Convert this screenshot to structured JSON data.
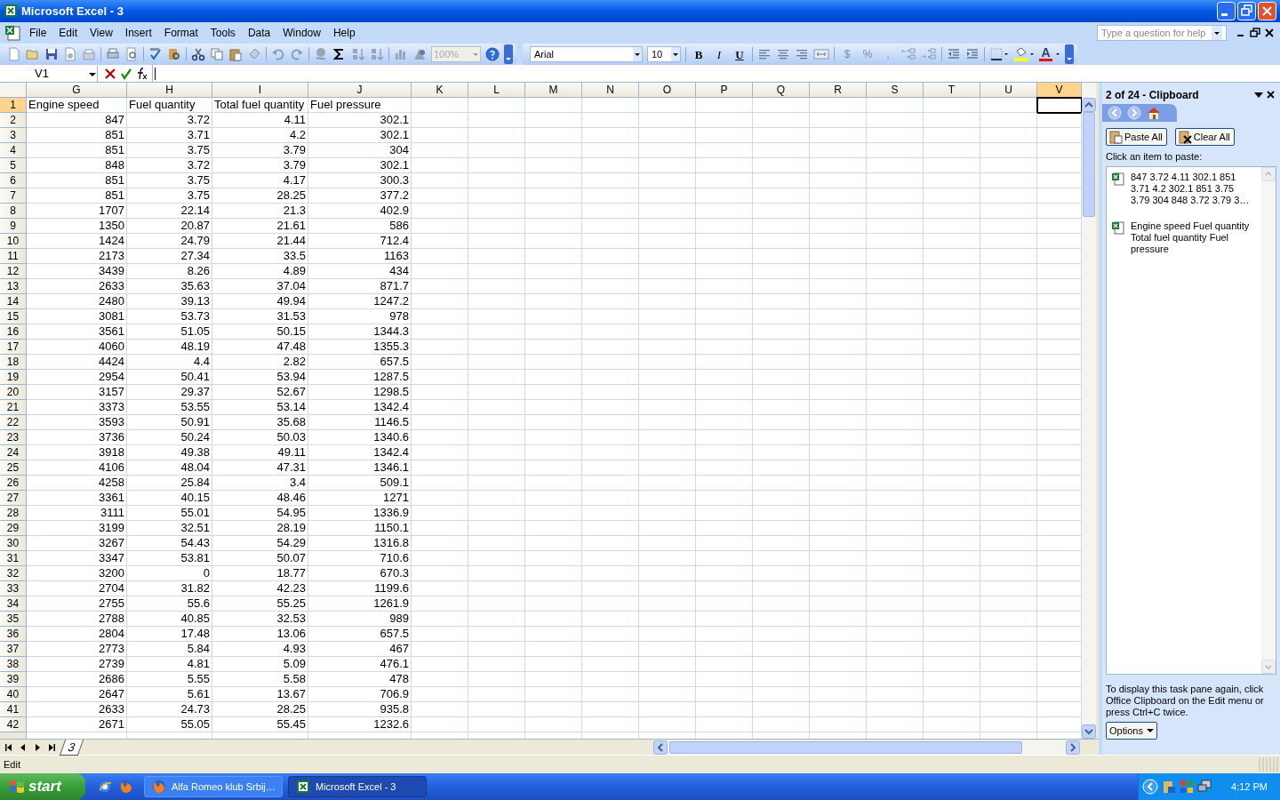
{
  "window": {
    "title": "Microsoft Excel - 3"
  },
  "menu": [
    {
      "label": "File"
    },
    {
      "label": "Edit"
    },
    {
      "label": "View"
    },
    {
      "label": "Insert"
    },
    {
      "label": "Format"
    },
    {
      "label": "Tools"
    },
    {
      "label": "Data"
    },
    {
      "label": "Window"
    },
    {
      "label": "Help"
    }
  ],
  "help_box": {
    "placeholder": "Type a question for help"
  },
  "standard_toolbar": {
    "zoom": "100%"
  },
  "formatting_toolbar": {
    "font": "Arial",
    "size": "10",
    "style_buttons": [
      "B",
      "I",
      "U"
    ],
    "number_buttons": [
      "$",
      "%",
      ","
    ],
    "font_color": "A"
  },
  "formula_bar": {
    "name_box": "V1"
  },
  "sheet": {
    "columns": [
      {
        "label": "G",
        "selected": false
      },
      {
        "label": "H",
        "selected": false
      },
      {
        "label": "I",
        "selected": false
      },
      {
        "label": "J",
        "selected": false
      },
      {
        "label": "K",
        "selected": false
      },
      {
        "label": "L",
        "selected": false
      },
      {
        "label": "M",
        "selected": false
      },
      {
        "label": "N",
        "selected": false
      },
      {
        "label": "O",
        "selected": false
      },
      {
        "label": "P",
        "selected": false
      },
      {
        "label": "Q",
        "selected": false
      },
      {
        "label": "R",
        "selected": false
      },
      {
        "label": "S",
        "selected": false
      },
      {
        "label": "T",
        "selected": false
      },
      {
        "label": "U",
        "selected": false
      },
      {
        "label": "V",
        "selected": true
      }
    ],
    "rows": [
      {
        "header": "1",
        "selected": true,
        "kind": "text",
        "cells": [
          "Engine speed",
          "Fuel quantity",
          "Total fuel quantity",
          "Fuel pressure"
        ]
      },
      {
        "header": "2",
        "selected": false,
        "kind": "number",
        "cells": [
          "847",
          "3.72",
          "4.11",
          "302.1"
        ]
      },
      {
        "header": "3",
        "selected": false,
        "kind": "number",
        "cells": [
          "851",
          "3.71",
          "4.2",
          "302.1"
        ]
      },
      {
        "header": "4",
        "selected": false,
        "kind": "number",
        "cells": [
          "851",
          "3.75",
          "3.79",
          "304"
        ]
      },
      {
        "header": "5",
        "selected": false,
        "kind": "number",
        "cells": [
          "848",
          "3.72",
          "3.79",
          "302.1"
        ]
      },
      {
        "header": "6",
        "selected": false,
        "kind": "number",
        "cells": [
          "851",
          "3.75",
          "4.17",
          "300.3"
        ]
      },
      {
        "header": "7",
        "selected": false,
        "kind": "number",
        "cells": [
          "851",
          "3.75",
          "28.25",
          "377.2"
        ]
      },
      {
        "header": "8",
        "selected": false,
        "kind": "number",
        "cells": [
          "1707",
          "22.14",
          "21.3",
          "402.9"
        ]
      },
      {
        "header": "9",
        "selected": false,
        "kind": "number",
        "cells": [
          "1350",
          "20.87",
          "21.61",
          "586"
        ]
      },
      {
        "header": "10",
        "selected": false,
        "kind": "number",
        "cells": [
          "1424",
          "24.79",
          "21.44",
          "712.4"
        ]
      },
      {
        "header": "11",
        "selected": false,
        "kind": "number",
        "cells": [
          "2173",
          "27.34",
          "33.5",
          "1163"
        ]
      },
      {
        "header": "12",
        "selected": false,
        "kind": "number",
        "cells": [
          "3439",
          "8.26",
          "4.89",
          "434"
        ]
      },
      {
        "header": "13",
        "selected": false,
        "kind": "number",
        "cells": [
          "2633",
          "35.63",
          "37.04",
          "871.7"
        ]
      },
      {
        "header": "14",
        "selected": false,
        "kind": "number",
        "cells": [
          "2480",
          "39.13",
          "49.94",
          "1247.2"
        ]
      },
      {
        "header": "15",
        "selected": false,
        "kind": "number",
        "cells": [
          "3081",
          "53.73",
          "31.53",
          "978"
        ]
      },
      {
        "header": "16",
        "selected": false,
        "kind": "number",
        "cells": [
          "3561",
          "51.05",
          "50.15",
          "1344.3"
        ]
      },
      {
        "header": "17",
        "selected": false,
        "kind": "number",
        "cells": [
          "4060",
          "48.19",
          "47.48",
          "1355.3"
        ]
      },
      {
        "header": "18",
        "selected": false,
        "kind": "number",
        "cells": [
          "4424",
          "4.4",
          "2.82",
          "657.5"
        ]
      },
      {
        "header": "19",
        "selected": false,
        "kind": "number",
        "cells": [
          "2954",
          "50.41",
          "53.94",
          "1287.5"
        ]
      },
      {
        "header": "20",
        "selected": false,
        "kind": "number",
        "cells": [
          "3157",
          "29.37",
          "52.67",
          "1298.5"
        ]
      },
      {
        "header": "21",
        "selected": false,
        "kind": "number",
        "cells": [
          "3373",
          "53.55",
          "53.14",
          "1342.4"
        ]
      },
      {
        "header": "22",
        "selected": false,
        "kind": "number",
        "cells": [
          "3593",
          "50.91",
          "35.68",
          "1146.5"
        ]
      },
      {
        "header": "23",
        "selected": false,
        "kind": "number",
        "cells": [
          "3736",
          "50.24",
          "50.03",
          "1340.6"
        ]
      },
      {
        "header": "24",
        "selected": false,
        "kind": "number",
        "cells": [
          "3918",
          "49.38",
          "49.11",
          "1342.4"
        ]
      },
      {
        "header": "25",
        "selected": false,
        "kind": "number",
        "cells": [
          "4106",
          "48.04",
          "47.31",
          "1346.1"
        ]
      },
      {
        "header": "26",
        "selected": false,
        "kind": "number",
        "cells": [
          "4258",
          "25.84",
          "3.4",
          "509.1"
        ]
      },
      {
        "header": "27",
        "selected": false,
        "kind": "number",
        "cells": [
          "3361",
          "40.15",
          "48.46",
          "1271"
        ]
      },
      {
        "header": "28",
        "selected": false,
        "kind": "number",
        "cells": [
          "3111",
          "55.01",
          "54.95",
          "1336.9"
        ]
      },
      {
        "header": "29",
        "selected": false,
        "kind": "number",
        "cells": [
          "3199",
          "32.51",
          "28.19",
          "1150.1"
        ]
      },
      {
        "header": "30",
        "selected": false,
        "kind": "number",
        "cells": [
          "3267",
          "54.43",
          "54.29",
          "1316.8"
        ]
      },
      {
        "header": "31",
        "selected": false,
        "kind": "number",
        "cells": [
          "3347",
          "53.81",
          "50.07",
          "710.6"
        ]
      },
      {
        "header": "32",
        "selected": false,
        "kind": "number",
        "cells": [
          "3200",
          "0",
          "18.77",
          "670.3"
        ]
      },
      {
        "header": "33",
        "selected": false,
        "kind": "number",
        "cells": [
          "2704",
          "31.82",
          "42.23",
          "1199.6"
        ]
      },
      {
        "header": "34",
        "selected": false,
        "kind": "number",
        "cells": [
          "2755",
          "55.6",
          "55.25",
          "1261.9"
        ]
      },
      {
        "header": "35",
        "selected": false,
        "kind": "number",
        "cells": [
          "2788",
          "40.85",
          "32.53",
          "989"
        ]
      },
      {
        "header": "36",
        "selected": false,
        "kind": "number",
        "cells": [
          "2804",
          "17.48",
          "13.06",
          "657.5"
        ]
      },
      {
        "header": "37",
        "selected": false,
        "kind": "number",
        "cells": [
          "2773",
          "5.84",
          "4.93",
          "467"
        ]
      },
      {
        "header": "38",
        "selected": false,
        "kind": "number",
        "cells": [
          "2739",
          "4.81",
          "5.09",
          "476.1"
        ]
      },
      {
        "header": "39",
        "selected": false,
        "kind": "number",
        "cells": [
          "2686",
          "5.55",
          "5.58",
          "478"
        ]
      },
      {
        "header": "40",
        "selected": false,
        "kind": "number",
        "cells": [
          "2647",
          "5.61",
          "13.67",
          "706.9"
        ]
      },
      {
        "header": "41",
        "selected": false,
        "kind": "number",
        "cells": [
          "2633",
          "24.73",
          "28.25",
          "935.8"
        ]
      },
      {
        "header": "42",
        "selected": false,
        "kind": "number",
        "cells": [
          "2671",
          "55.05",
          "55.45",
          "1232.6"
        ]
      }
    ]
  },
  "sheet_tabs": [
    {
      "label": "3",
      "selected": true
    }
  ],
  "status_bar": {
    "mode": "Edit"
  },
  "task_pane": {
    "title": "2 of 24 - Clipboard",
    "buttons": [
      "Paste All",
      "Clear All"
    ],
    "instruction": "Click an item to paste:",
    "items": [
      {
        "text": "847 3.72 4.11 302.1 851 3.71 4.2 302.1 851 3.75 3.79 304 848 3.72 3.79 3…"
      },
      {
        "text": "Engine speed Fuel quantity Total fuel quantity Fuel pressure"
      }
    ],
    "footer": "To display this task pane again, click Office Clipboard on the Edit menu or press Ctrl+C twice.",
    "options": "Options"
  },
  "taskbar": {
    "start": "start",
    "tasks": [
      {
        "label": "Alfa Romeo klub Srbij…",
        "selected": false
      },
      {
        "label": "Microsoft Excel - 3",
        "selected": true
      }
    ],
    "clock": "4:12 PM"
  }
}
